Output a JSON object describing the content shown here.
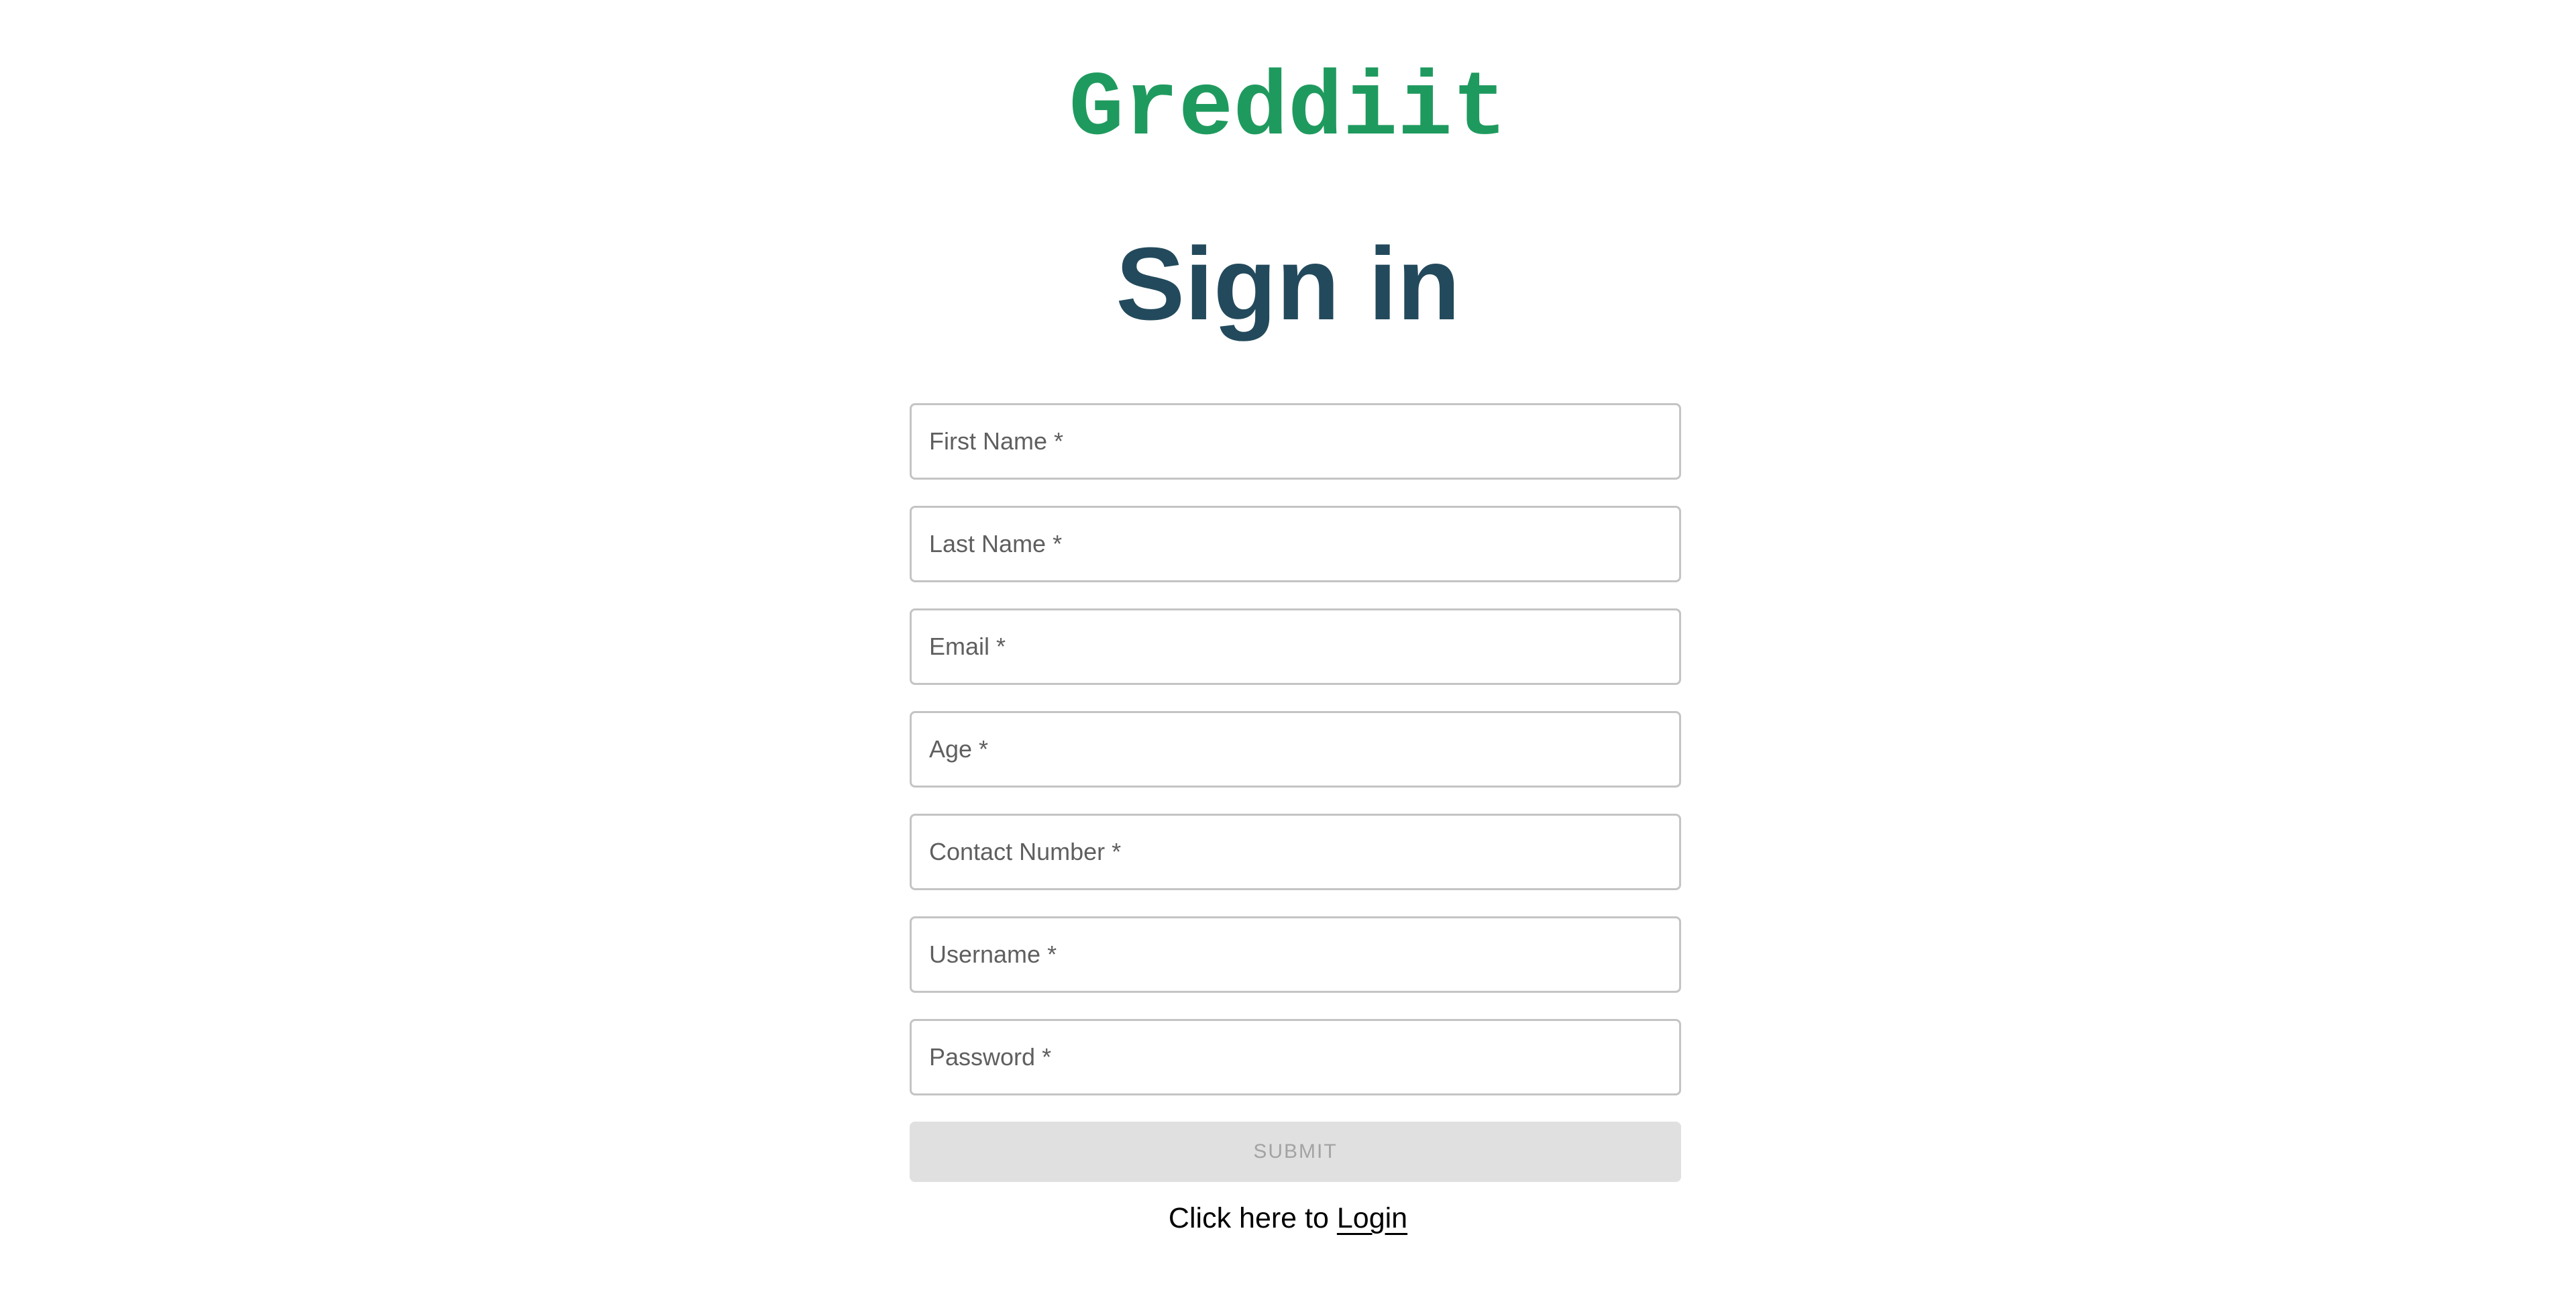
{
  "header": {
    "logo_text": "Greddiit",
    "title": "Sign in"
  },
  "form": {
    "fields": [
      {
        "placeholder": "First Name *",
        "value": ""
      },
      {
        "placeholder": "Last Name *",
        "value": ""
      },
      {
        "placeholder": "Email *",
        "value": ""
      },
      {
        "placeholder": "Age *",
        "value": ""
      },
      {
        "placeholder": "Contact Number *",
        "value": ""
      },
      {
        "placeholder": "Username *",
        "value": ""
      },
      {
        "placeholder": "Password *",
        "value": ""
      }
    ],
    "submit_label": "SUBMIT",
    "submit_disabled": true
  },
  "footer": {
    "prompt_text": "Click here to",
    "login_link": "Login"
  },
  "colors": {
    "logo": "#1f9a5e",
    "title": "#234a5c",
    "field_border": "#c4c4c4",
    "submit_background": "#e0e0e0",
    "submit_text": "#a3a3a3"
  }
}
